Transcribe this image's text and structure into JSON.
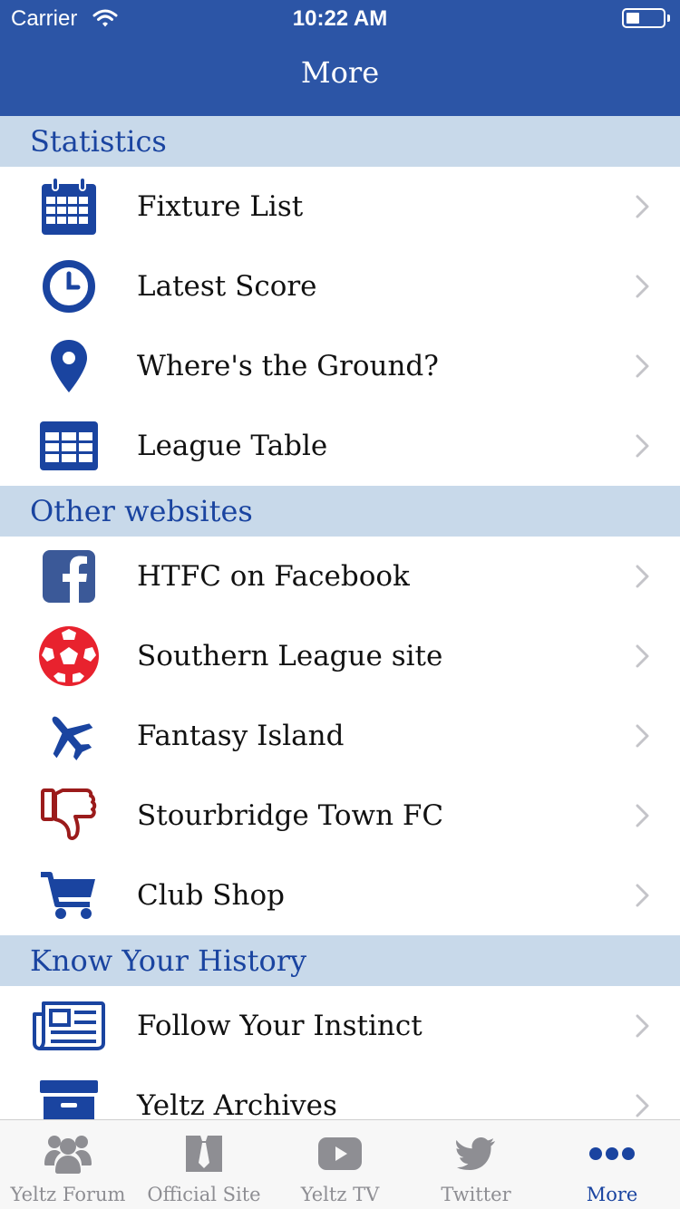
{
  "status_bar": {
    "carrier": "Carrier",
    "time": "10:22 AM"
  },
  "nav": {
    "title": "More"
  },
  "colors": {
    "brand": "#2c55a6",
    "icon_blue": "#1a44a0",
    "section_bg": "#c8d9ea",
    "facebook": "#3b5998",
    "ball_red": "#e8222e",
    "thumb_red": "#9b1b1b"
  },
  "sections": [
    {
      "title": "Statistics",
      "items": [
        {
          "label": "Fixture List",
          "icon": "calendar-icon"
        },
        {
          "label": "Latest Score",
          "icon": "clock-icon"
        },
        {
          "label": "Where's the Ground?",
          "icon": "map-pin-icon"
        },
        {
          "label": "League Table",
          "icon": "table-icon"
        }
      ]
    },
    {
      "title": "Other websites",
      "items": [
        {
          "label": "HTFC on Facebook",
          "icon": "facebook-icon"
        },
        {
          "label": "Southern League site",
          "icon": "soccer-ball-icon"
        },
        {
          "label": "Fantasy Island",
          "icon": "airplane-icon"
        },
        {
          "label": "Stourbridge Town FC",
          "icon": "thumbs-down-icon"
        },
        {
          "label": "Club Shop",
          "icon": "shopping-cart-icon"
        }
      ]
    },
    {
      "title": "Know Your History",
      "items": [
        {
          "label": "Follow Your Instinct",
          "icon": "newspaper-icon"
        },
        {
          "label": "Yeltz Archives",
          "icon": "archive-box-icon"
        }
      ]
    }
  ],
  "tabs": [
    {
      "label": "Yeltz Forum",
      "icon": "users-icon",
      "active": false
    },
    {
      "label": "Official Site",
      "icon": "tie-icon",
      "active": false
    },
    {
      "label": "Yeltz TV",
      "icon": "youtube-icon",
      "active": false
    },
    {
      "label": "Twitter",
      "icon": "twitter-bird-icon",
      "active": false
    },
    {
      "label": "More",
      "icon": "more-dots-icon",
      "active": true
    }
  ]
}
